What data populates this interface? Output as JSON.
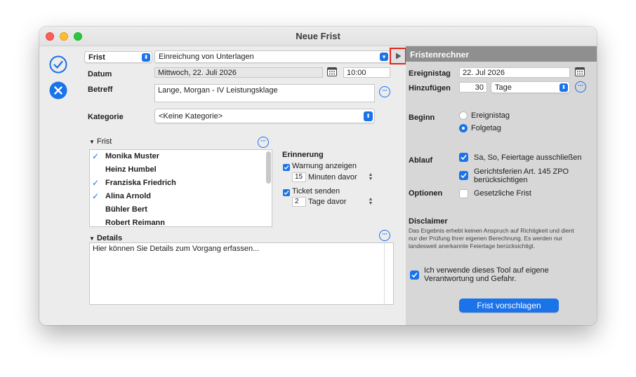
{
  "window": {
    "title": "Neue Frist"
  },
  "colors": {
    "accent": "#1a73e8",
    "highlight": "#e8221b",
    "sidebar_header": "#8f8f8f"
  },
  "toolbar": {
    "confirm_icon": "checkmark-circle-icon",
    "cancel_icon": "x-circle-icon"
  },
  "form": {
    "type_select": "Frist",
    "task_select": "Einreichung von Unterlagen",
    "datum_label": "Datum",
    "datum_value": "Mittwoch, 22. Juli 2026",
    "time_value": "10:00",
    "betreff_label": "Betreff",
    "betreff_value": "Lange, Morgan - IV Leistungsklage",
    "kategorie_label": "Kategorie",
    "kategorie_value": "<Keine Kategorie>"
  },
  "frist": {
    "section_label": "Frist",
    "people": [
      {
        "name": "Monika Muster",
        "checked": true
      },
      {
        "name": "Heinz Humbel",
        "checked": false
      },
      {
        "name": "Franziska Friedrich",
        "checked": true
      },
      {
        "name": "Alina Arnold",
        "checked": true
      },
      {
        "name": "Bühler Bert",
        "checked": false
      },
      {
        "name": "Robert Reimann",
        "checked": false
      }
    ]
  },
  "erinnerung": {
    "title": "Erinnerung",
    "warnung_label": "Warnung anzeigen",
    "warnung_amount": "15",
    "warnung_unit": "Minuten davor",
    "ticket_label": "Ticket senden",
    "ticket_amount": "2",
    "ticket_unit": "Tage davor"
  },
  "details": {
    "label": "Details",
    "placeholder": "Hier können Sie Details zum Vorgang erfassen..."
  },
  "calc": {
    "header": "Fristenrechner",
    "ereignistag_label": "Ereignistag",
    "ereignistag_value": "22. Jul 2026",
    "hinzufuegen_label": "Hinzufügen",
    "hinzufuegen_amount": "30",
    "hinzufuegen_unit": "Tage",
    "beginn_label": "Beginn",
    "beginn_options": [
      "Ereignistag",
      "Folgetag"
    ],
    "beginn_selected": "Folgetag",
    "ablauf_label": "Ablauf",
    "ablauf_opt1": "Sa, So, Feiertage ausschließen",
    "ablauf_opt2a": "Gerichtsferien Art. 145 ZPO",
    "ablauf_opt2b": "berücksichtigen",
    "optionen_label": "Optionen",
    "optionen_opt": "Gesetzliche Frist",
    "disclaimer_title": "Disclaimer",
    "disclaimer_l1": "Das Ergebnis erhebt keinen Anspruch auf Richtigkeit und dient",
    "disclaimer_l2": "nur der Prüfung Ihrer eigenen Berechnung. Es werden nur",
    "disclaimer_l3": "landesweit anerkannte Feiertage berücksichtigt.",
    "agree_l1": "Ich verwende dieses Tool auf eigene",
    "agree_l2": "Verantwortung und Gefahr.",
    "submit_label": "Frist vorschlagen"
  }
}
